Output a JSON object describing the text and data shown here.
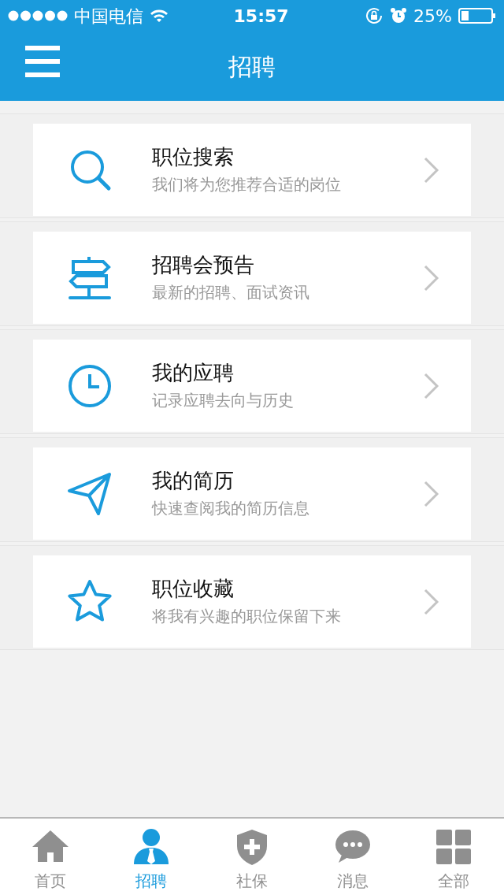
{
  "status_bar": {
    "carrier": "中国电信",
    "time": "15:57",
    "battery": "25%"
  },
  "nav_bar": {
    "title": "招聘"
  },
  "items": [
    {
      "title": "职位搜索",
      "subtitle": "我们将为您推荐合适的岗位"
    },
    {
      "title": "招聘会预告",
      "subtitle": "最新的招聘、面试资讯"
    },
    {
      "title": "我的应聘",
      "subtitle": "记录应聘去向与历史"
    },
    {
      "title": "我的简历",
      "subtitle": "快速查阅我的简历信息"
    },
    {
      "title": "职位收藏",
      "subtitle": "将我有兴趣的职位保留下来"
    }
  ],
  "tabs": [
    {
      "label": "首页",
      "selected": false
    },
    {
      "label": "招聘",
      "selected": true
    },
    {
      "label": "社保",
      "selected": false
    },
    {
      "label": "消息",
      "selected": false
    },
    {
      "label": "全部",
      "selected": false
    }
  ]
}
